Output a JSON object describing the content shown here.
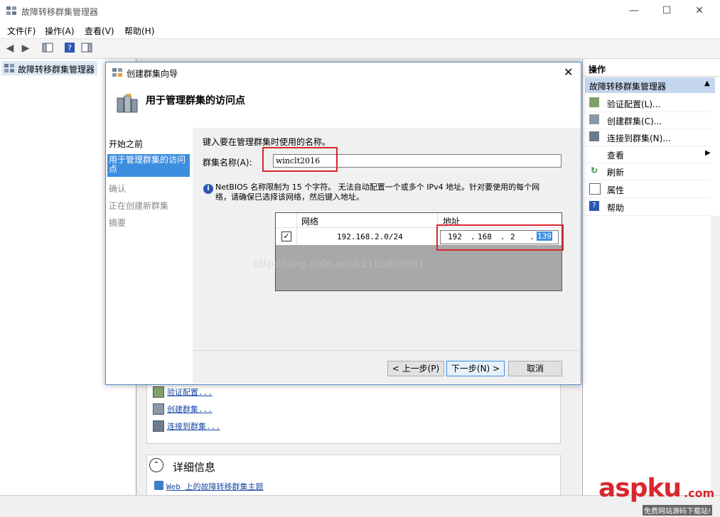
{
  "window": {
    "title": "故障转移群集管理器",
    "minimize": "—",
    "maximize": "☐",
    "close": "✕"
  },
  "menu": [
    "文件(F)",
    "操作(A)",
    "查看(V)",
    "帮助(H)"
  ],
  "tree": {
    "root": "故障转移群集管理器"
  },
  "center": {
    "links": [
      "验证配置...",
      "创建群集...",
      "连接到群集..."
    ],
    "details_title": "详细信息",
    "details_link": "Web 上的故障转移群集主题"
  },
  "actions": {
    "header": "操作",
    "group": "故障转移群集管理器",
    "items": [
      "验证配置(L)...",
      "创建群集(C)...",
      "连接到群集(N)...",
      "查看",
      "刷新",
      "属性",
      "帮助"
    ]
  },
  "wizard": {
    "title": "创建群集向导",
    "header": "用于管理群集的访问点",
    "nav": [
      "开始之前",
      "用于管理群集的访问点",
      "确认",
      "正在创建新群集",
      "摘要"
    ],
    "instruction": "键入要在管理群集时使用的名称。",
    "cluster_name_label": "群集名称(A):",
    "cluster_name_value": "winclt2016",
    "info_line1": "NetBIOS 名称限制为 15 个字符。 无法自动配置一个或多个 IPv4 地址。针对要使用的每个网",
    "info_line2": "络，请确保已选择该网络，然后键入地址。",
    "table": {
      "col_network": "网络",
      "col_address": "地址",
      "row": {
        "network": "192.168.2.0/24",
        "ip": [
          "192",
          "168",
          "2",
          "139"
        ]
      }
    },
    "buttons": {
      "prev": "< 上一步(P)",
      "next": "下一步(N) >",
      "cancel": "取消"
    },
    "watermark": "http://blog.csdn.net/kk185800961"
  },
  "brand": {
    "logo": "aspku",
    "logo_suffix": ".com",
    "tagline": "免费网站源码下载站!"
  }
}
